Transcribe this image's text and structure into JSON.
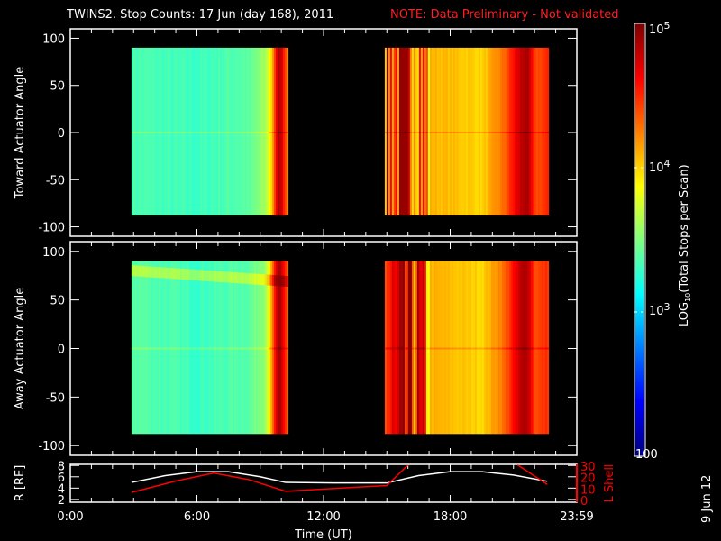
{
  "title": "TWINS2. Stop Counts: 17 Jun (day 168), 2011",
  "note": "NOTE: Data Preliminary - Not validated",
  "datestamp": "9 Jun 12",
  "colors": {
    "note": "#ff2020",
    "lshell": "#ff0000",
    "radius": "#ffffff",
    "axis": "#ffffff"
  },
  "chart_data": [
    {
      "type": "heatmap",
      "name": "toward",
      "ylabel": "Toward Actuator Angle",
      "ylim": [
        -110,
        110
      ],
      "yticks": [
        "100",
        "50",
        "0",
        "-50",
        "-100"
      ],
      "ytick_values": [
        100,
        50,
        0,
        -50,
        -100
      ],
      "angle_range": [
        -88,
        90
      ],
      "segments": [
        {
          "t": [
            2.9,
            10.3
          ],
          "profile": [
            [
              2.9,
              3.35
            ],
            [
              6,
              3.3
            ],
            [
              8.5,
              3.4
            ],
            [
              9.2,
              3.6
            ],
            [
              9.5,
              4.0
            ],
            [
              9.7,
              4.6
            ],
            [
              9.85,
              4.9
            ],
            [
              10.0,
              4.7
            ],
            [
              10.3,
              4.2
            ]
          ]
        },
        {
          "t": [
            14.9,
            22.6
          ],
          "profile": [
            [
              14.9,
              4.5
            ],
            [
              16.5,
              4.5
            ],
            [
              17.0,
              4.1
            ],
            [
              19.5,
              4.0
            ],
            [
              20.5,
              4.3
            ],
            [
              21.3,
              4.8
            ],
            [
              21.6,
              4.9
            ],
            [
              22.0,
              4.4
            ],
            [
              22.6,
              4.5
            ]
          ],
          "noisy": true
        }
      ]
    },
    {
      "type": "heatmap",
      "name": "away",
      "ylabel": "Away Actuator Angle",
      "ylim": [
        -110,
        110
      ],
      "yticks": [
        "100",
        "50",
        "0",
        "-50",
        "-100"
      ],
      "ytick_values": [
        100,
        50,
        0,
        -50,
        -100
      ],
      "angle_range": [
        -88,
        90
      ],
      "segments": [
        {
          "t": [
            2.9,
            10.3
          ],
          "profile": [
            [
              2.9,
              3.4
            ],
            [
              6,
              3.3
            ],
            [
              8.5,
              3.4
            ],
            [
              9.2,
              3.6
            ],
            [
              9.5,
              4.1
            ],
            [
              9.7,
              4.7
            ],
            [
              9.85,
              4.9
            ],
            [
              10.0,
              4.7
            ],
            [
              10.3,
              4.3
            ]
          ]
        },
        {
          "t": [
            14.9,
            22.6
          ],
          "profile": [
            [
              14.9,
              4.5
            ],
            [
              16.5,
              4.5
            ],
            [
              17.0,
              4.1
            ],
            [
              19.5,
              4.0
            ],
            [
              20.5,
              4.3
            ],
            [
              21.3,
              4.8
            ],
            [
              21.6,
              4.9
            ],
            [
              22.0,
              4.4
            ],
            [
              22.6,
              4.5
            ]
          ],
          "noisy": true
        }
      ]
    },
    {
      "type": "line",
      "name": "orbit",
      "xlabel": "Time (UT)",
      "xticks": [
        "0:00",
        "6:00",
        "12:00",
        "18:00",
        "23:59"
      ],
      "xtick_values": [
        0,
        6,
        12,
        18,
        24
      ],
      "ylabel": "R [RE]",
      "ylim": [
        1.5,
        8.2
      ],
      "yticks": [
        "8",
        "6",
        "4",
        "2"
      ],
      "ytick_values": [
        8,
        6,
        4,
        2
      ],
      "y2label": "L Shell",
      "y2lim": [
        0,
        30
      ],
      "y2ticks": [
        "30",
        "20",
        "10",
        "0"
      ],
      "y2tick_values": [
        30,
        20,
        10,
        0
      ],
      "series": [
        {
          "name": "R",
          "axis": "left",
          "points": [
            [
              2.9,
              5.0
            ],
            [
              4.5,
              6.2
            ],
            [
              6,
              6.9
            ],
            [
              7.5,
              6.9
            ],
            [
              9,
              6.0
            ],
            [
              10.2,
              5.0
            ],
            [
              12.5,
              4.9
            ],
            [
              15,
              4.9
            ],
            [
              16.5,
              6.2
            ],
            [
              18,
              6.9
            ],
            [
              19.5,
              6.9
            ],
            [
              21,
              6.3
            ],
            [
              22.6,
              5.2
            ]
          ]
        },
        {
          "name": "L Shell",
          "axis": "right",
          "points": [
            [
              2.9,
              7
            ],
            [
              5,
              17
            ],
            [
              6.8,
              24
            ],
            [
              8.5,
              18
            ],
            [
              10.2,
              8
            ],
            [
              12,
              10
            ],
            [
              15,
              13
            ],
            [
              16,
              31
            ]
          ]
        },
        {
          "name": "L Shell 2",
          "axis": "right",
          "points": [
            [
              21.2,
              31
            ],
            [
              22.6,
              14
            ]
          ]
        }
      ]
    },
    {
      "type": "colorbar",
      "label": "LOG10(Total Stops per Scan)",
      "range_log": [
        2,
        5
      ],
      "ticks": [
        "100",
        "10^3",
        "10^4",
        "10^5"
      ],
      "tick_values": [
        2,
        3,
        4,
        5
      ]
    }
  ],
  "labels": {
    "cb_100": "100",
    "cb_3": "10",
    "cb_3e": "3",
    "cb_4": "10",
    "cb_4e": "4",
    "cb_5": "10",
    "cb_5e": "5",
    "cb_title": "LOG",
    "cb_sub": "10",
    "cb_rest": "(Total Stops per Scan)"
  }
}
